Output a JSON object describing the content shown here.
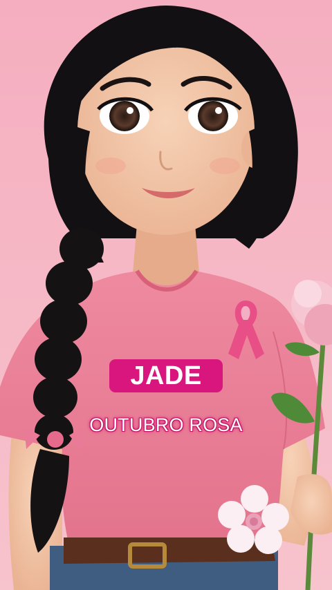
{
  "overlay": {
    "name": "JADE",
    "campaign": "OUTUBRO ROSA"
  },
  "colors": {
    "background": "#f4b9c6",
    "badge": "#d9167e",
    "shirt": "#e9788f",
    "hair": "#121012",
    "skin": "#f3c6a8"
  }
}
